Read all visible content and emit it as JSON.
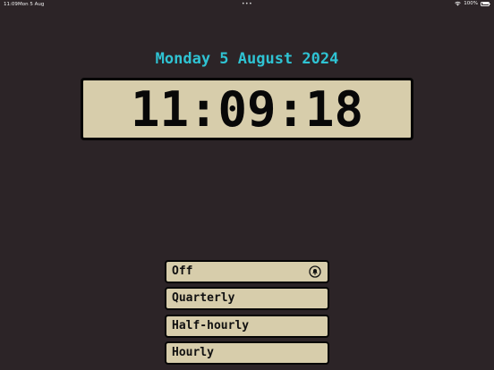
{
  "status_bar": {
    "time": "11:09",
    "date": "Mon 5 Aug",
    "dots": "•••",
    "battery": "100%",
    "icons": [
      "wifi-icon",
      "battery-icon"
    ]
  },
  "clock": {
    "date": "Monday 5 August 2024",
    "time": "11:09:18"
  },
  "chime_options": [
    {
      "label": "Off",
      "selected": true,
      "icon": "bell-icon"
    },
    {
      "label": "Quarterly",
      "selected": false
    },
    {
      "label": "Half-hourly",
      "selected": false
    },
    {
      "label": "Hourly",
      "selected": false
    }
  ],
  "colors": {
    "background": "#2c2427",
    "accent_date": "#2fc3d3",
    "panel": "#d7cdab",
    "border": "#050505",
    "text_dark": "#080808"
  }
}
